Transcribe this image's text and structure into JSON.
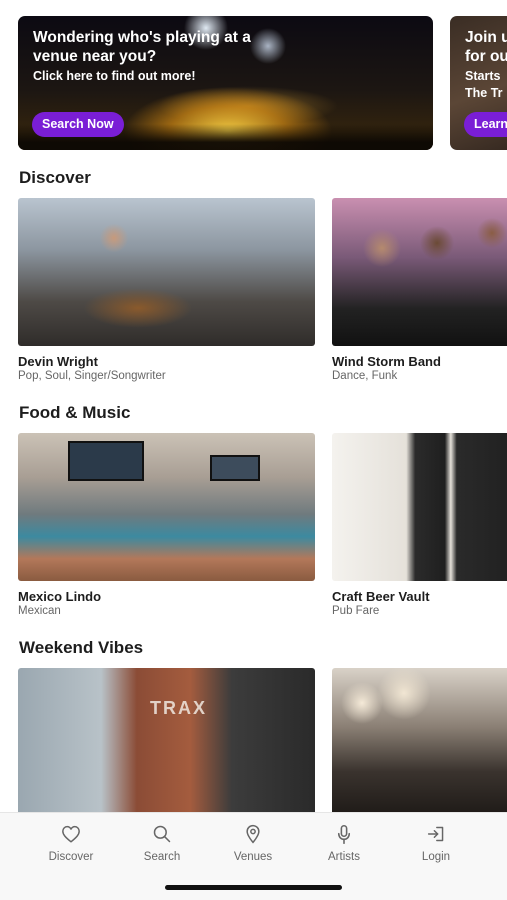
{
  "banners": [
    {
      "title": "Wondering who's playing at a venue near you?",
      "subtitle": "Click here to find out more!",
      "button": "Search Now"
    },
    {
      "title": "Join u for ou",
      "subtitle": "Starts The Tr",
      "button": "Learn"
    }
  ],
  "sections": [
    {
      "title": "Discover",
      "cards": [
        {
          "name": "Devin Wright",
          "subtitle": "Pop, Soul, Singer/Songwriter"
        },
        {
          "name": "Wind Storm Band",
          "subtitle": "Dance, Funk"
        }
      ]
    },
    {
      "title": "Food & Music",
      "cards": [
        {
          "name": "Mexico Lindo",
          "subtitle": "Mexican"
        },
        {
          "name": "Craft Beer Vault",
          "subtitle": "Pub Fare"
        }
      ]
    },
    {
      "title": "Weekend Vibes",
      "cards": [
        {
          "name": "",
          "subtitle": "",
          "image_text": "TRAX"
        },
        {
          "name": "",
          "subtitle": ""
        }
      ]
    }
  ],
  "tabs": [
    {
      "label": "Discover",
      "icon": "heart-icon"
    },
    {
      "label": "Search",
      "icon": "search-icon"
    },
    {
      "label": "Venues",
      "icon": "location-pin-icon"
    },
    {
      "label": "Artists",
      "icon": "microphone-icon"
    },
    {
      "label": "Login",
      "icon": "login-icon"
    }
  ],
  "colors": {
    "accent": "#7a1ed6",
    "tab_icon": "#666666"
  }
}
